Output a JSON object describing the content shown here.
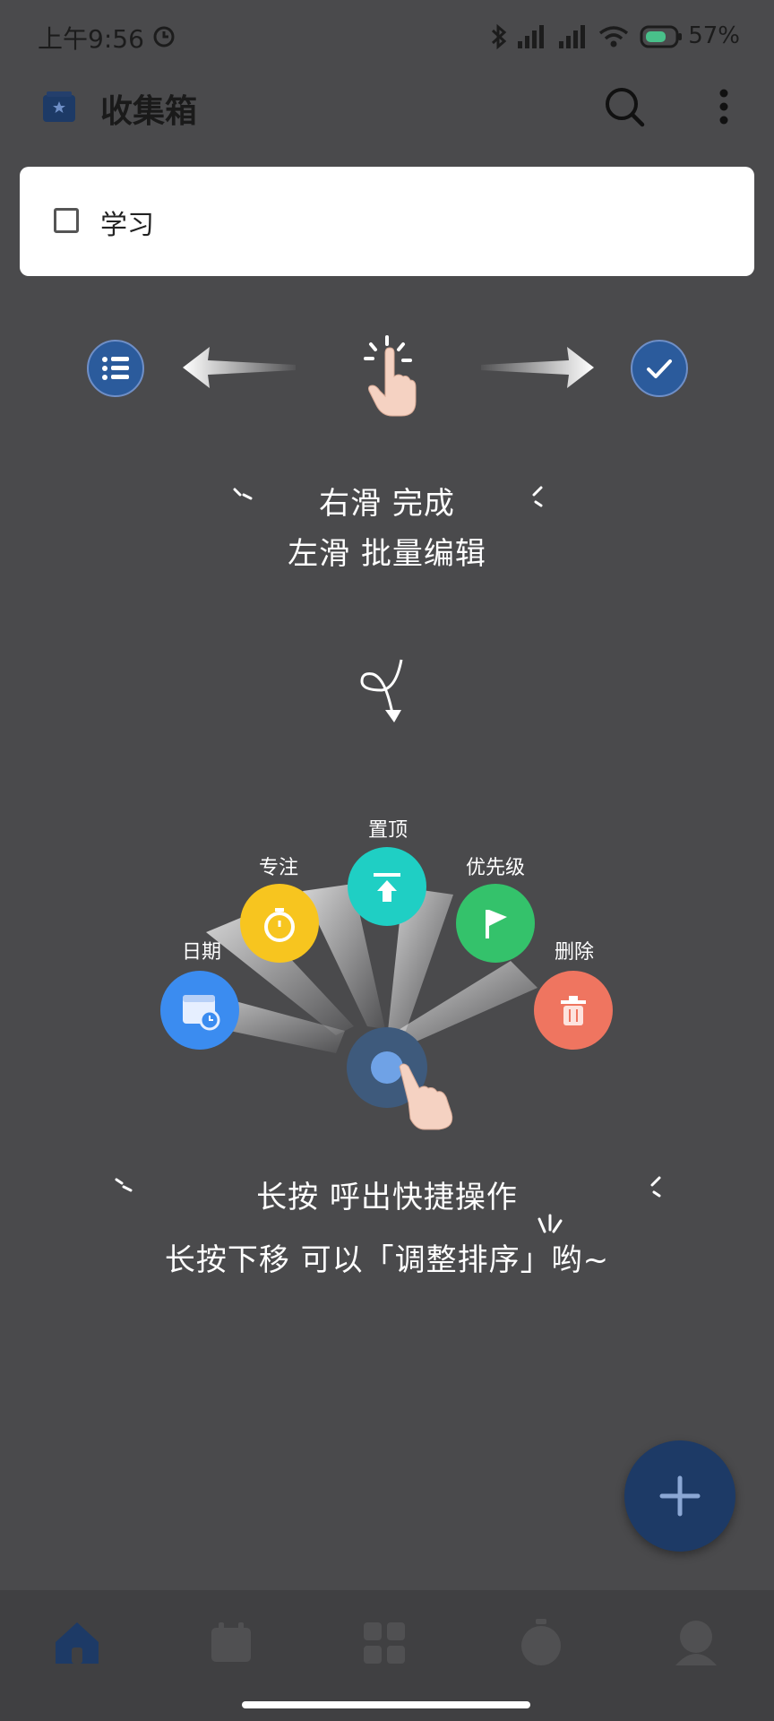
{
  "status_bar": {
    "time": "上午9:56",
    "battery": "57%"
  },
  "app_bar": {
    "title": "收集箱",
    "icons": [
      "inbox-icon",
      "search-icon",
      "more-vert-icon"
    ]
  },
  "task": {
    "title": "学习",
    "checked": false
  },
  "swipe_guide": {
    "line1": "右滑 完成",
    "line2": "左滑 批量编辑",
    "left_icon": "list-icon",
    "right_icon": "check-icon"
  },
  "quick_actions": {
    "items": [
      {
        "label": "日期",
        "icon": "calendar-icon",
        "color": "#3b8cf0"
      },
      {
        "label": "专注",
        "icon": "timer-icon",
        "color": "#f7c51f"
      },
      {
        "label": "置顶",
        "icon": "pin-top-icon",
        "color": "#1fcfc4"
      },
      {
        "label": "优先级",
        "icon": "flag-icon",
        "color": "#34c26b"
      },
      {
        "label": "删除",
        "icon": "trash-icon",
        "color": "#ef7560"
      }
    ]
  },
  "press_guide": {
    "line1": "长按 呼出快捷操作",
    "line2": "长按下移 可以「调整排序」哟~"
  },
  "fab": {
    "icon": "plus-icon"
  },
  "bottom_nav": {
    "items": [
      "home-icon",
      "calendar-icon",
      "grid-icon",
      "timer-icon",
      "profile-icon"
    ]
  }
}
